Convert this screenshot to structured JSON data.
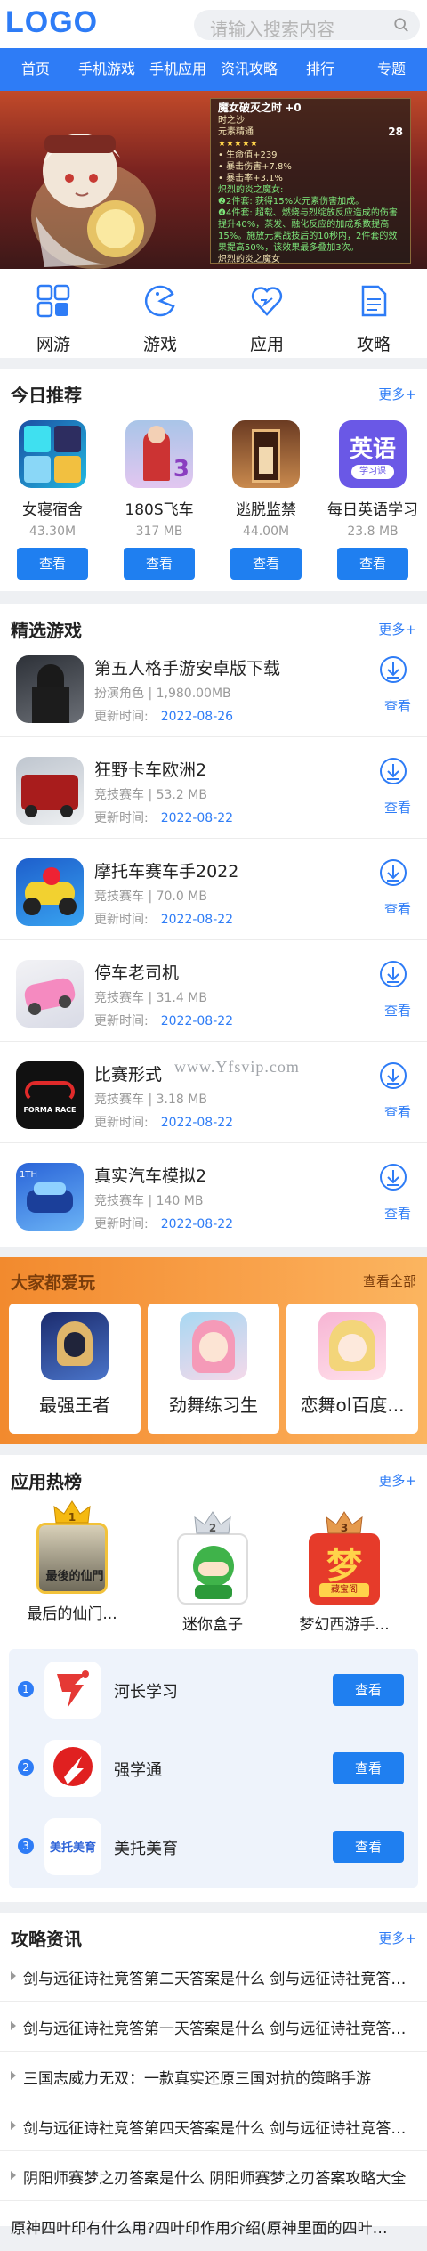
{
  "header": {
    "logo": "LOGO",
    "search_placeholder": "请输入搜索内容"
  },
  "nav": [
    "首页",
    "手机游戏",
    "手机应用",
    "资讯攻略",
    "排行",
    "专题"
  ],
  "banner": {
    "title": "魔女破灭之时",
    "plus": "+0",
    "sub": "时之沙",
    "stat_name": "元素精通",
    "stat_val": "28",
    "lines": [
      "• 生命值+239",
      "• 暴击伤害+7.8%",
      "• 暴击率+3.1%"
    ],
    "set2": "炽烈的炎之魔女:",
    "set2_desc": "❷2件套: 获得15%火元素伤害加成。",
    "set4_desc": "❹4件套: 超载、燃烧与烈绽放反应造成的伤害提升40%，蒸发、融化反应的加成系数提高15%。施放元素战技后的10秒内，2件套的效果提高50%，该效果最多叠加3次。",
    "set_footer": "炽烈的炎之魔女"
  },
  "quick": [
    "网游",
    "游戏",
    "应用",
    "攻略"
  ],
  "today": {
    "title": "今日推荐",
    "more": "更多+",
    "items": [
      {
        "name": "女寝宿舍",
        "size": "43.30M",
        "btn": "查看"
      },
      {
        "name": "180S飞车",
        "size": "317 MB",
        "btn": "查看"
      },
      {
        "name": "逃脱监禁",
        "size": "44.00M",
        "btn": "查看"
      },
      {
        "name": "每日英语学习",
        "size": "23.8 MB",
        "btn": "查看"
      }
    ],
    "english_icon_top": "英语",
    "english_icon_bottom": "学习课"
  },
  "games": {
    "title": "精选游戏",
    "more": "更多+",
    "update_label": "更新时间:",
    "download": "查看",
    "items": [
      {
        "name": "第五人格手游安卓版下载",
        "meta": "扮演角色 | 1,980.00MB",
        "date": "2022-08-26"
      },
      {
        "name": "狂野卡车欧洲2",
        "meta": "竞技赛车 | 53.2 MB",
        "date": "2022-08-22"
      },
      {
        "name": "摩托车赛车手2022",
        "meta": "竞技赛车 | 70.0 MB",
        "date": "2022-08-22"
      },
      {
        "name": "停车老司机",
        "meta": "竞技赛车 | 31.4 MB",
        "date": "2022-08-22"
      },
      {
        "name": "比赛形式",
        "meta": "竞技赛车 | 3.18 MB",
        "date": "2022-08-22"
      },
      {
        "name": "真实汽车模拟2",
        "meta": "竞技赛车 | 140 MB",
        "date": "2022-08-22"
      }
    ],
    "form_race_logo": "FORMA RACE"
  },
  "watermark": "www.Yfsvip.com",
  "love": {
    "title": "大家都爱玩",
    "more": "查看全部",
    "items": [
      "最强王者",
      "劲舞练习生",
      "恋舞ol百度..."
    ]
  },
  "hot": {
    "title": "应用热榜",
    "more": "更多+",
    "top": [
      {
        "name": "最后的仙门...",
        "rank": "1",
        "icon_text": "最後的仙門"
      },
      {
        "name": "迷你盒子",
        "rank": "2"
      },
      {
        "name": "梦幻西游手...",
        "rank": "3",
        "icon_text": "梦",
        "icon_sub": "藏宝阁"
      }
    ],
    "list": [
      {
        "num": "1",
        "name": "河长学习",
        "btn": "查看"
      },
      {
        "num": "2",
        "name": "强学通",
        "btn": "查看"
      },
      {
        "num": "3",
        "name": "美托美育",
        "btn": "查看",
        "icon_text": "美托美育"
      }
    ]
  },
  "articles": {
    "title": "攻略资讯",
    "more": "更多+",
    "items": [
      "剑与远征诗社竞答第二天答案是什么 剑与远征诗社竞答第二天答案",
      "剑与远征诗社竞答第一天答案是什么 剑与远征诗社竞答第一天答案",
      "三国志威力无双：一款真实还原三国对抗的策略手游",
      "剑与远征诗社竞答第四天答案是什么 剑与远征诗社竞答第四天答案",
      "阴阳师赛梦之刃答案是什么 阴阳师赛梦之刃答案攻略大全",
      "原神四叶印有什么用?四叶印作用介绍(原神里面的四叶印是什么)"
    ]
  },
  "colors": {
    "accent": "#2e7cf6",
    "button": "#1f7ff0",
    "love_bg": "#f59a3e"
  }
}
